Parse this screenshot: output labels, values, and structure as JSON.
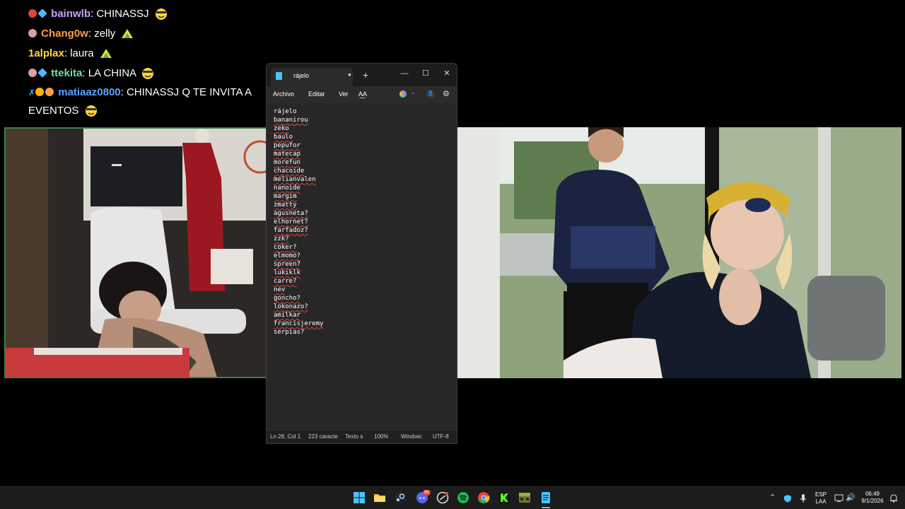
{
  "chat": [
    {
      "user": "bainwlb",
      "user_color": "#c9a0ff",
      "message": ": CHINASSJ",
      "badges": [
        "#e0463a",
        "#4fb6ff"
      ]
    },
    {
      "user": "Chang0w",
      "user_color": "#ff9f43",
      "message": ": zelly",
      "badges": [
        "#e07a7a"
      ]
    },
    {
      "user": "1alplax",
      "user_color": "#ffd84a",
      "message": ": laura",
      "badges": []
    },
    {
      "user": "ttekita",
      "user_color": "#6fe39a",
      "message": ": LA CHINA",
      "badges": [
        "#e07a7a",
        "#4fb6ff"
      ]
    },
    {
      "user": "matiaaz0800",
      "user_color": "#5aa2ff",
      "message_1": ": CHINASSJ Q TE INVITA A",
      "message_2": "EVENTOS",
      "badges": [
        "#4fb6ff",
        "#ffb400",
        "#ff9f43"
      ]
    }
  ],
  "notepad": {
    "tab_title": "rájelo",
    "menu": {
      "archivo": "Archivo",
      "editar": "Editar",
      "ver": "Ver",
      "format_glyph": "A͟A"
    },
    "lines": [
      "rájelo",
      "bananirou",
      "zeko",
      "baulo",
      "pepufor",
      "matecap",
      "morefun",
      "chacoide",
      "melianvalen",
      "nanoide",
      "margim",
      "zmatty",
      "agusneta?",
      "elhornet?",
      "farfadoz?",
      "zzk?",
      "coker?",
      "elmomo?",
      "spreen?",
      "lukiklk",
      "carre?",
      "nev",
      "goncho?",
      "lokonazo?",
      "amilkar",
      "francisjeremy",
      "serpias?"
    ],
    "status": {
      "position": "Ln 28, Col 1",
      "chars": "223 caracte",
      "format": "Texto s",
      "zoom": "100%",
      "eol": "Window:",
      "encoding": "UTF-8"
    }
  },
  "taskbar": {
    "lang_1": "ESP",
    "lang_2": "LAA",
    "time": "06:49",
    "date": "9/1/2026",
    "discord_badge": "99"
  }
}
